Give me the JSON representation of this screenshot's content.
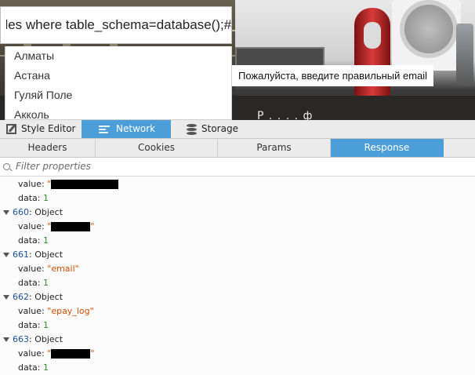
{
  "webpage": {
    "search_value": "bles where table_schema=database();#",
    "autocomplete_options": [
      "Алматы",
      "Астана",
      "Гуляй Поле",
      "Акколь"
    ],
    "tooltip": "Пожалуйста, введите правильный email",
    "partial_banner_text": "Р . . . . ф"
  },
  "devtools": {
    "tools_tabs": [
      {
        "label": "Style Editor",
        "icon": "style-editor-icon",
        "selected": false
      },
      {
        "label": "Network",
        "icon": "network-icon",
        "selected": true
      },
      {
        "label": "Storage",
        "icon": "storage-icon",
        "selected": false
      }
    ],
    "sub_tabs": [
      {
        "label": "Headers",
        "selected": false
      },
      {
        "label": "Cookies",
        "selected": false
      },
      {
        "label": "Params",
        "selected": false
      },
      {
        "label": "Response",
        "selected": true
      }
    ],
    "filter_placeholder": "Filter properties",
    "tree": {
      "first_value_label": "value:",
      "first_value_prefix": "\"",
      "first_data_label": "data:",
      "first_data_value": "1",
      "objects": [
        {
          "index": "660",
          "type": "Object",
          "value": "",
          "value_redacted": true,
          "data": "1"
        },
        {
          "index": "661",
          "type": "Object",
          "value": "email",
          "value_redacted": false,
          "data": "1"
        },
        {
          "index": "662",
          "type": "Object",
          "value": "epay_log",
          "value_redacted": false,
          "data": "1"
        },
        {
          "index": "663",
          "type": "Object",
          "value": "",
          "value_redacted": true,
          "data": "1"
        }
      ]
    },
    "colors": {
      "selected_tab": "#4c9ed9",
      "string_value": "#d34c00",
      "number_value": "#2a8a2a",
      "index": "#1b4f9a"
    }
  }
}
